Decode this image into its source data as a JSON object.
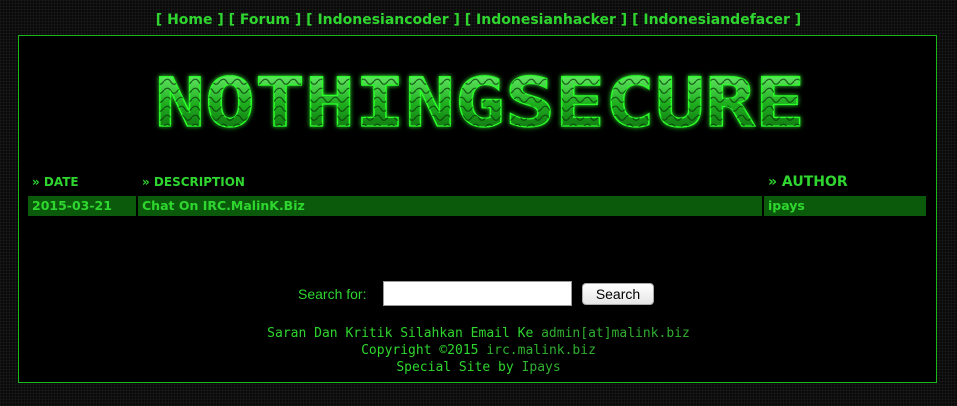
{
  "nav": {
    "items": [
      "Home",
      "Forum",
      "Indonesiancoder",
      "Indonesianhacker",
      "Indonesiandefacer"
    ]
  },
  "logo": {
    "text": "NOTHINGSECURE"
  },
  "table": {
    "headers": {
      "date": "» DATE",
      "description": "» DESCRIPTION",
      "author": "» AUTHOR"
    },
    "rows": [
      {
        "date": "2015-03-21",
        "description": "Chat On IRC.MalinK.Biz",
        "author": "ipays"
      }
    ]
  },
  "search": {
    "label": "Search for:",
    "value": "",
    "button_label": "Search"
  },
  "footer": {
    "line1_text": "Saran Dan Kritik Silahkan Email Ke",
    "line1_link": "admin[at]malink.biz",
    "line2_text": "Copyright ©2015",
    "line2_link": "irc.malink.biz",
    "line3_text": "Special Site by",
    "line3_link": "Ipays"
  },
  "colors": {
    "accent": "#2fd62f",
    "row_bg": "#0b5a0b",
    "frame_border": "#1bb81b",
    "background": "#000000"
  }
}
